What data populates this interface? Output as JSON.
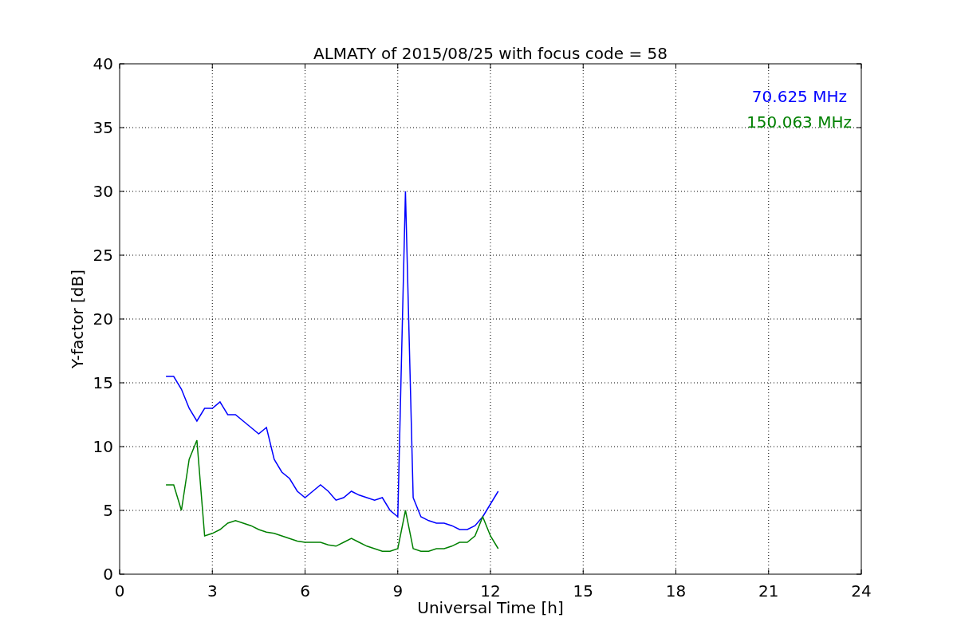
{
  "chart_data": {
    "type": "line",
    "title": "ALMATY of 2015/08/25 with focus code = 58",
    "xlabel": "Universal Time [h]",
    "ylabel": "Y-factor [dB]",
    "x": [
      1.5,
      1.75,
      2.0,
      2.25,
      2.5,
      2.75,
      3.0,
      3.25,
      3.5,
      3.75,
      4.0,
      4.25,
      4.5,
      4.75,
      5.0,
      5.25,
      5.5,
      5.75,
      6.0,
      6.25,
      6.5,
      6.75,
      7.0,
      7.25,
      7.5,
      7.75,
      8.0,
      8.25,
      8.5,
      8.75,
      9.0,
      9.25,
      9.5,
      9.75,
      10.0,
      10.25,
      10.5,
      10.75,
      11.0,
      11.25,
      11.5,
      11.75,
      12.0,
      12.25
    ],
    "series": [
      {
        "name": "70.625 MHz",
        "color": "#0000ff",
        "values": [
          15.5,
          15.5,
          14.5,
          13,
          12,
          13,
          13,
          13.5,
          12.5,
          12.5,
          12,
          11.5,
          11,
          11.5,
          9,
          8,
          7.5,
          6.5,
          6,
          6.5,
          7,
          6.5,
          5.8,
          6,
          6.5,
          6.2,
          6,
          5.8,
          6,
          5,
          4.5,
          30,
          6,
          4.5,
          4.2,
          4,
          4,
          3.8,
          3.5,
          3.5,
          3.8,
          4.5,
          5.5,
          6.5
        ]
      },
      {
        "name": "150.063 MHz",
        "color": "#008000",
        "values": [
          7,
          7,
          5,
          9,
          10.5,
          3,
          3.2,
          3.5,
          4,
          4.2,
          4,
          3.8,
          3.5,
          3.3,
          3.2,
          3,
          2.8,
          2.6,
          2.5,
          2.5,
          2.5,
          2.3,
          2.2,
          2.5,
          2.8,
          2.5,
          2.2,
          2,
          1.8,
          1.8,
          2,
          5,
          2,
          1.8,
          1.8,
          2,
          2,
          2.2,
          2.5,
          2.5,
          3,
          4.5,
          3,
          2
        ]
      }
    ],
    "xlim": [
      0,
      24
    ],
    "ylim": [
      0,
      40
    ],
    "xticks": [
      0,
      3,
      6,
      9,
      12,
      15,
      18,
      21,
      24
    ],
    "yticks": [
      0,
      5,
      10,
      15,
      20,
      25,
      30,
      35,
      40
    ],
    "grid": true
  }
}
